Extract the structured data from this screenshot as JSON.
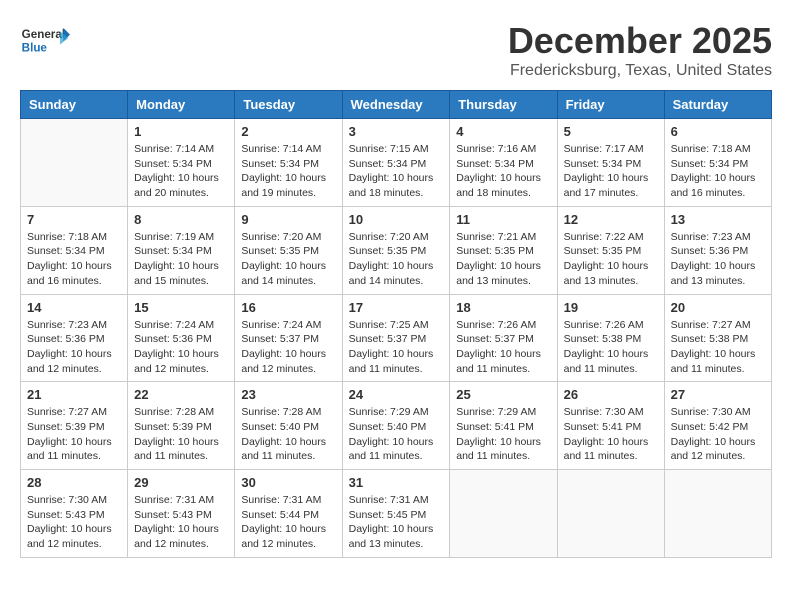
{
  "header": {
    "logo_general": "General",
    "logo_blue": "Blue",
    "month_year": "December 2025",
    "location": "Fredericksburg, Texas, United States"
  },
  "weekdays": [
    "Sunday",
    "Monday",
    "Tuesday",
    "Wednesday",
    "Thursday",
    "Friday",
    "Saturday"
  ],
  "weeks": [
    [
      {
        "day": "",
        "empty": true
      },
      {
        "day": "1",
        "sunrise": "7:14 AM",
        "sunset": "5:34 PM",
        "daylight": "10 hours and 20 minutes."
      },
      {
        "day": "2",
        "sunrise": "7:14 AM",
        "sunset": "5:34 PM",
        "daylight": "10 hours and 19 minutes."
      },
      {
        "day": "3",
        "sunrise": "7:15 AM",
        "sunset": "5:34 PM",
        "daylight": "10 hours and 18 minutes."
      },
      {
        "day": "4",
        "sunrise": "7:16 AM",
        "sunset": "5:34 PM",
        "daylight": "10 hours and 18 minutes."
      },
      {
        "day": "5",
        "sunrise": "7:17 AM",
        "sunset": "5:34 PM",
        "daylight": "10 hours and 17 minutes."
      },
      {
        "day": "6",
        "sunrise": "7:18 AM",
        "sunset": "5:34 PM",
        "daylight": "10 hours and 16 minutes."
      }
    ],
    [
      {
        "day": "7",
        "sunrise": "7:18 AM",
        "sunset": "5:34 PM",
        "daylight": "10 hours and 16 minutes."
      },
      {
        "day": "8",
        "sunrise": "7:19 AM",
        "sunset": "5:34 PM",
        "daylight": "10 hours and 15 minutes."
      },
      {
        "day": "9",
        "sunrise": "7:20 AM",
        "sunset": "5:35 PM",
        "daylight": "10 hours and 14 minutes."
      },
      {
        "day": "10",
        "sunrise": "7:20 AM",
        "sunset": "5:35 PM",
        "daylight": "10 hours and 14 minutes."
      },
      {
        "day": "11",
        "sunrise": "7:21 AM",
        "sunset": "5:35 PM",
        "daylight": "10 hours and 13 minutes."
      },
      {
        "day": "12",
        "sunrise": "7:22 AM",
        "sunset": "5:35 PM",
        "daylight": "10 hours and 13 minutes."
      },
      {
        "day": "13",
        "sunrise": "7:23 AM",
        "sunset": "5:36 PM",
        "daylight": "10 hours and 13 minutes."
      }
    ],
    [
      {
        "day": "14",
        "sunrise": "7:23 AM",
        "sunset": "5:36 PM",
        "daylight": "10 hours and 12 minutes."
      },
      {
        "day": "15",
        "sunrise": "7:24 AM",
        "sunset": "5:36 PM",
        "daylight": "10 hours and 12 minutes."
      },
      {
        "day": "16",
        "sunrise": "7:24 AM",
        "sunset": "5:37 PM",
        "daylight": "10 hours and 12 minutes."
      },
      {
        "day": "17",
        "sunrise": "7:25 AM",
        "sunset": "5:37 PM",
        "daylight": "10 hours and 11 minutes."
      },
      {
        "day": "18",
        "sunrise": "7:26 AM",
        "sunset": "5:37 PM",
        "daylight": "10 hours and 11 minutes."
      },
      {
        "day": "19",
        "sunrise": "7:26 AM",
        "sunset": "5:38 PM",
        "daylight": "10 hours and 11 minutes."
      },
      {
        "day": "20",
        "sunrise": "7:27 AM",
        "sunset": "5:38 PM",
        "daylight": "10 hours and 11 minutes."
      }
    ],
    [
      {
        "day": "21",
        "sunrise": "7:27 AM",
        "sunset": "5:39 PM",
        "daylight": "10 hours and 11 minutes."
      },
      {
        "day": "22",
        "sunrise": "7:28 AM",
        "sunset": "5:39 PM",
        "daylight": "10 hours and 11 minutes."
      },
      {
        "day": "23",
        "sunrise": "7:28 AM",
        "sunset": "5:40 PM",
        "daylight": "10 hours and 11 minutes."
      },
      {
        "day": "24",
        "sunrise": "7:29 AM",
        "sunset": "5:40 PM",
        "daylight": "10 hours and 11 minutes."
      },
      {
        "day": "25",
        "sunrise": "7:29 AM",
        "sunset": "5:41 PM",
        "daylight": "10 hours and 11 minutes."
      },
      {
        "day": "26",
        "sunrise": "7:30 AM",
        "sunset": "5:41 PM",
        "daylight": "10 hours and 11 minutes."
      },
      {
        "day": "27",
        "sunrise": "7:30 AM",
        "sunset": "5:42 PM",
        "daylight": "10 hours and 12 minutes."
      }
    ],
    [
      {
        "day": "28",
        "sunrise": "7:30 AM",
        "sunset": "5:43 PM",
        "daylight": "10 hours and 12 minutes."
      },
      {
        "day": "29",
        "sunrise": "7:31 AM",
        "sunset": "5:43 PM",
        "daylight": "10 hours and 12 minutes."
      },
      {
        "day": "30",
        "sunrise": "7:31 AM",
        "sunset": "5:44 PM",
        "daylight": "10 hours and 12 minutes."
      },
      {
        "day": "31",
        "sunrise": "7:31 AM",
        "sunset": "5:45 PM",
        "daylight": "10 hours and 13 minutes."
      },
      {
        "day": "",
        "empty": true
      },
      {
        "day": "",
        "empty": true
      },
      {
        "day": "",
        "empty": true
      }
    ]
  ],
  "labels": {
    "sunrise_prefix": "Sunrise: ",
    "sunset_prefix": "Sunset: ",
    "daylight_prefix": "Daylight: "
  }
}
